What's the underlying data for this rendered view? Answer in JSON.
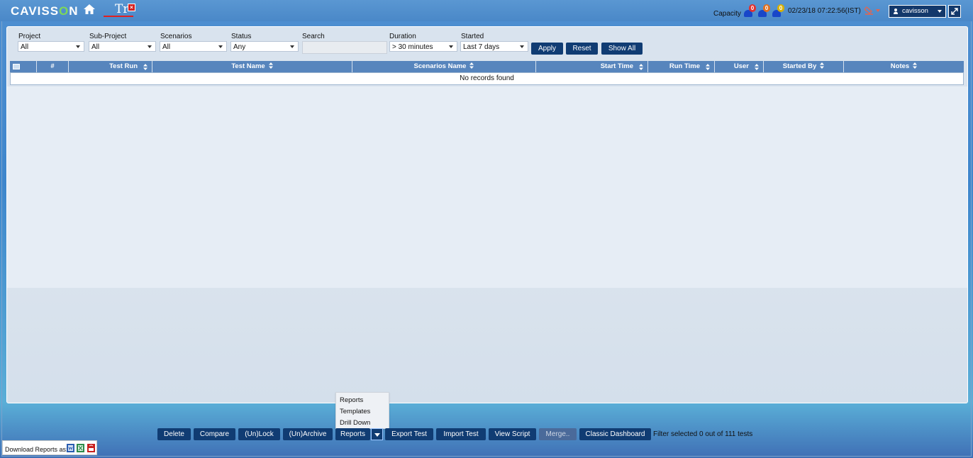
{
  "header": {
    "logo_text_a": "CAVISS",
    "logo_text_o": "O",
    "logo_text_b": "N",
    "tr_icon_text": "Tr",
    "capacity_label": "Capacity",
    "alerts": [
      {
        "count": "0",
        "color": "#e03030"
      },
      {
        "count": "0",
        "color": "#e07020"
      },
      {
        "count": "0",
        "color": "#d8b000"
      }
    ],
    "datetime": "02/23/18 07:22:56(IST)",
    "user_label": "cavisson"
  },
  "filters": {
    "project": {
      "label": "Project",
      "value": "All"
    },
    "sub_project": {
      "label": "Sub-Project",
      "value": "All"
    },
    "scenarios": {
      "label": "Scenarios",
      "value": "All"
    },
    "status": {
      "label": "Status",
      "value": "Any"
    },
    "search": {
      "label": "Search",
      "value": ""
    },
    "duration": {
      "label": "Duration",
      "value": "> 30 minutes"
    },
    "started": {
      "label": "Started",
      "value": "Last 7 days"
    },
    "apply_label": "Apply",
    "reset_label": "Reset",
    "show_all_label": "Show All"
  },
  "table": {
    "columns": {
      "num": "#",
      "test_run": "Test Run",
      "test_name": "Test Name",
      "scenarios_name": "Scenarios Name",
      "start_time": "Start Time",
      "run_time": "Run Time",
      "user": "User",
      "started_by": "Started By",
      "notes": "Notes"
    },
    "empty_message": "No records found"
  },
  "reports_menu": {
    "items": [
      "Reports",
      "Templates",
      "Drill Down"
    ]
  },
  "actions": {
    "delete": "Delete",
    "compare": "Compare",
    "unlock": "(Un)Lock",
    "unarchive": "(Un)Archive",
    "reports": "Reports",
    "export_test": "Export Test",
    "import_test": "Import Test",
    "view_script": "View Script",
    "merge": "Merge..",
    "classic_dashboard": "Classic Dashboard",
    "filter_status": "Filter selected 0 out of 111 tests"
  },
  "download": {
    "label": "Download Reports as:",
    "formats": [
      "word-icon",
      "excel-icon",
      "pdf-icon"
    ]
  },
  "colors": {
    "button_bg": "#103c73",
    "table_header_bg": "#5785bd",
    "header_bg": "#4a88c8"
  }
}
